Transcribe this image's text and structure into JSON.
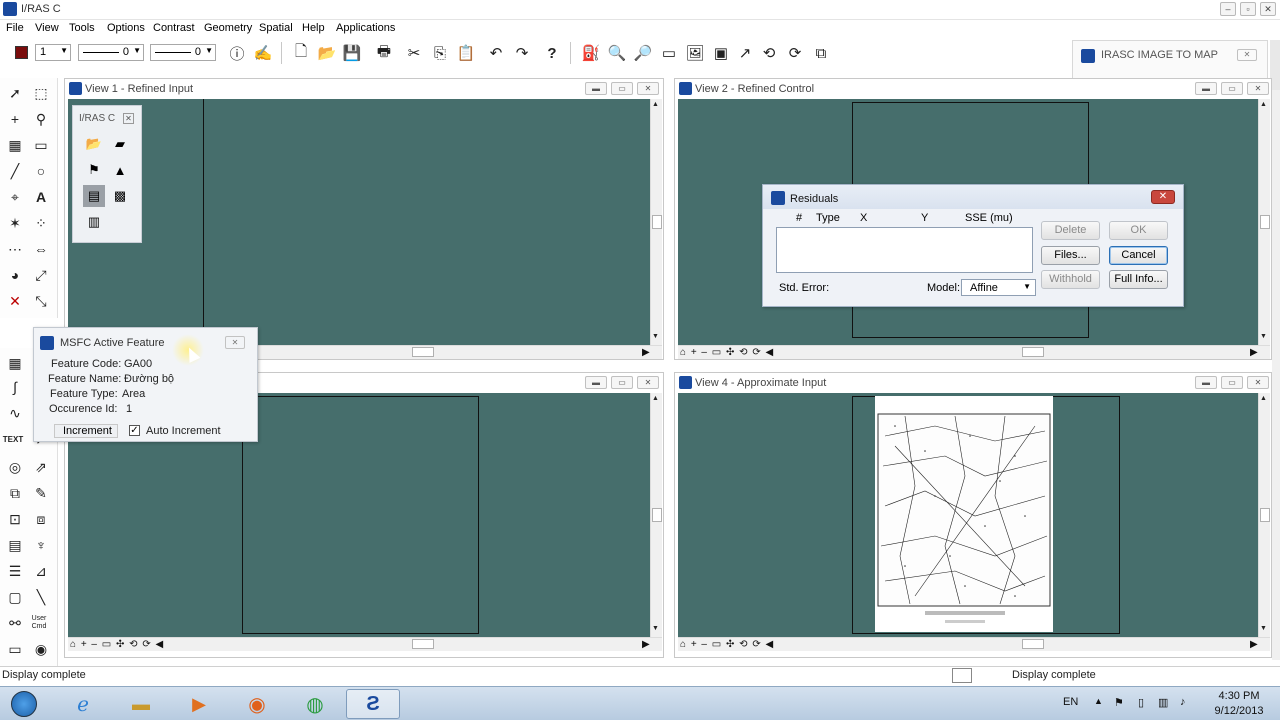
{
  "app": {
    "title": "I/RAS C",
    "menus": [
      "File",
      "View",
      "Tools",
      "Options",
      "Contrast",
      "Geometry",
      "Spatial",
      "Help",
      "Applications"
    ]
  },
  "toolbar": {
    "weight_value": "1",
    "style1_value": "0",
    "style2_value": "0",
    "buttons": [
      "info",
      "signature",
      "new-file",
      "open-folder",
      "save",
      "print",
      "cut",
      "copy",
      "paste",
      "undo",
      "redo",
      "help",
      "fill",
      "zoom-in",
      "zoom-out",
      "fit",
      "image",
      "arrow",
      "rotate-left",
      "rotate-right",
      "tile"
    ]
  },
  "image_to_map_panel": {
    "title": "IRASC IMAGE TO MAP"
  },
  "views": [
    {
      "title": "View 1 - Refined Input"
    },
    {
      "title": "View 2 - Refined Control"
    },
    {
      "title": ""
    },
    {
      "title": "View 4 - Approximate Input"
    }
  ],
  "irasc_palette": {
    "title": "I/RAS C"
  },
  "residuals": {
    "title": "Residuals",
    "columns": [
      "#",
      "Type",
      "X",
      "Y",
      "SSE (mu)"
    ],
    "rows": [],
    "std_error_label": "Std. Error:",
    "model_label": "Model:",
    "model_value": "Affine",
    "buttons": {
      "delete": "Delete",
      "ok": "OK",
      "files": "Files...",
      "cancel": "Cancel",
      "withhold": "Withhold",
      "full_info": "Full Info..."
    }
  },
  "msfc": {
    "title": "MSFC Active Feature",
    "feature_code_label": "Feature Code:",
    "feature_code": "GA00",
    "feature_name_label": "Feature Name:",
    "feature_name": "Đường bộ",
    "feature_type_label": "Feature Type:",
    "feature_type": "Area",
    "occurrence_label": "Occurence Id:",
    "occurrence_id": "1",
    "increment_label": "Increment",
    "auto_increment_label": "Auto Increment",
    "auto_increment_checked": true
  },
  "palette_text": {
    "text_tool": "TEXT",
    "user_cmd": "User Cmd"
  },
  "status": {
    "left": "Display complete",
    "right": "Display complete"
  },
  "taskbar": {
    "language": "EN",
    "time": "4:30 PM",
    "date": "9/12/2013"
  },
  "colors": {
    "view_background": "#466e6c",
    "dialog_background": "#eff2f7",
    "taskbar": "#c4d5e8"
  }
}
